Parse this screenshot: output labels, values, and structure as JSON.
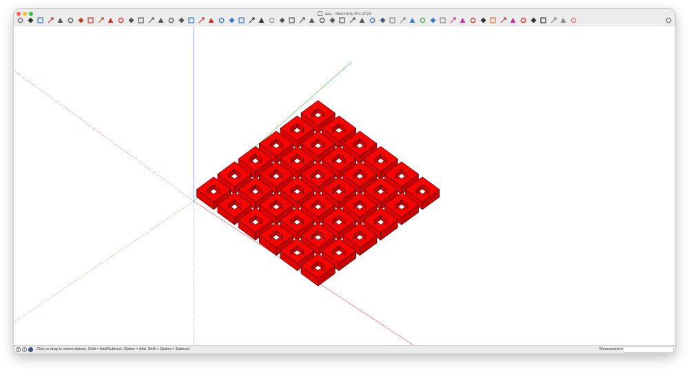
{
  "window": {
    "title": "aaa - SketchUp Pro 2023"
  },
  "traffic_lights": {
    "close": "#ff5f57",
    "minimize": "#febc2e",
    "zoom": "#28c840"
  },
  "toolbar": {
    "tools": [
      {
        "name": "search-icon",
        "color": "#6b6b6b"
      },
      {
        "name": "select-tool-icon",
        "color": "#333333"
      },
      {
        "name": "eraser-tool-icon",
        "color": "#3a78c9"
      },
      {
        "name": "line-tool-icon",
        "color": "#c0392b"
      },
      {
        "name": "arc-tool-icon",
        "color": "#555555"
      },
      {
        "name": "rectangle-tool-icon",
        "color": "#555555"
      },
      {
        "name": "push-pull-tool-icon",
        "color": "#c0392b"
      },
      {
        "name": "offset-tool-icon",
        "color": "#c0392b"
      },
      {
        "name": "move-tool-icon",
        "color": "#c0392b"
      },
      {
        "name": "rotate-tool-icon",
        "color": "#c0392b"
      },
      {
        "name": "scale-tool-icon",
        "color": "#c0392b"
      },
      {
        "name": "tape-measure-icon",
        "color": "#555555"
      },
      {
        "name": "protractor-icon",
        "color": "#555555"
      },
      {
        "name": "orbit-tool-icon",
        "color": "#555555"
      },
      {
        "name": "pan-tool-icon",
        "color": "#555555"
      },
      {
        "name": "zoom-tool-icon",
        "color": "#555555"
      },
      {
        "name": "zoom-extents-icon",
        "color": "#555555"
      },
      {
        "name": "text-tool-icon",
        "color": "#3a78c9"
      },
      {
        "name": "dimension-tool-icon",
        "color": "#c0392b"
      },
      {
        "name": "section-plane-icon",
        "color": "#c0392b"
      },
      {
        "name": "3d-text-icon",
        "color": "#3a78c9"
      },
      {
        "name": "axes-tool-icon",
        "color": "#3a78c9"
      },
      {
        "name": "paint-bucket-icon",
        "color": "#3a78c9"
      },
      {
        "name": "walk-tool-icon",
        "color": "#333333"
      },
      {
        "name": "look-around-icon",
        "color": "#333333"
      },
      {
        "name": "text-label-icon",
        "color": "#999999"
      },
      {
        "name": "iso-view-icon",
        "color": "#555555"
      },
      {
        "name": "top-view-icon",
        "color": "#555555"
      },
      {
        "name": "front-view-icon",
        "color": "#555555"
      },
      {
        "name": "right-view-icon",
        "color": "#555555"
      },
      {
        "name": "back-view-icon",
        "color": "#555555"
      },
      {
        "name": "left-view-icon",
        "color": "#555555"
      },
      {
        "name": "bottom-view-icon",
        "color": "#555555"
      },
      {
        "name": "xray-style-icon",
        "color": "#555555"
      },
      {
        "name": "wireframe-style-icon",
        "color": "#555555"
      },
      {
        "name": "hidden-line-style-icon",
        "color": "#3a78c9"
      },
      {
        "name": "component-icon",
        "color": "#3d5a7a"
      },
      {
        "name": "group-icon",
        "color": "#888888"
      },
      {
        "name": "copy-icon",
        "color": "#888888"
      },
      {
        "name": "solid-tools-icon",
        "color": "#3a78c9"
      },
      {
        "name": "sandbox-icon",
        "color": "#4aa84a"
      },
      {
        "name": "water-drop-icon",
        "color": "#3a78c9"
      },
      {
        "name": "fog-icon",
        "color": "#888888"
      },
      {
        "name": "dimension-style-icon",
        "color": "#cc3399"
      },
      {
        "name": "layout-send-icon",
        "color": "#cc3399"
      },
      {
        "name": "extension-warehouse-icon",
        "color": "#c0392b"
      },
      {
        "name": "warehouse-icon",
        "color": "#333333"
      },
      {
        "name": "terrain-icon",
        "color": "#e07020"
      },
      {
        "name": "geo-location-icon",
        "color": "#c0392b"
      },
      {
        "name": "photo-texture-icon",
        "color": "#cc3399"
      },
      {
        "name": "model-info-icon",
        "color": "#c0392b"
      },
      {
        "name": "undo-icon",
        "color": "#333333"
      },
      {
        "name": "redo-icon",
        "color": "#333333"
      },
      {
        "name": "follow-me-icon",
        "color": "#888888"
      },
      {
        "name": "tag-icon",
        "color": "#888888"
      },
      {
        "name": "outliner-icon",
        "color": "#e08080"
      }
    ],
    "right_icon": {
      "name": "share-icon",
      "color": "#777777"
    }
  },
  "model": {
    "box_color": "#ff0000",
    "edge_color": "#3a0000",
    "rows": 6,
    "cols": 6
  },
  "axes": {
    "green": "#5fbf5f",
    "red": "#e06060",
    "blue": "#6a90d8",
    "grey": "#c8c8c8"
  },
  "statusbar": {
    "message": "Click or drag to select objects. Shift = Add/Subtract. Option = Add. Shift + Option = Subtract.",
    "measurements_label": "Measurements",
    "measurements_value": ""
  }
}
